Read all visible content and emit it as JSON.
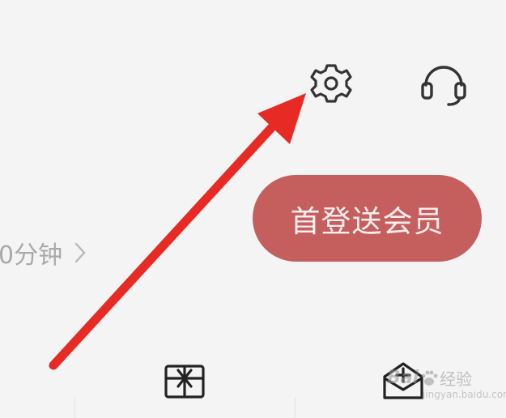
{
  "toolbar": {
    "settings_icon": "gear-icon",
    "support_icon": "headset-icon"
  },
  "promo_button": {
    "label": "首登送会员",
    "color": "#c45f5d"
  },
  "listen_duration": {
    "text": "0分钟",
    "chevron_icon": "chevron-right-icon"
  },
  "annotation": {
    "arrow_color": "#e82a25"
  },
  "bottom_icons": [
    "gift-icon",
    "mailbox-plus-icon"
  ],
  "watermark": {
    "brand": "Bai",
    "label": "经验",
    "url": "jingyan.baidu.com"
  }
}
